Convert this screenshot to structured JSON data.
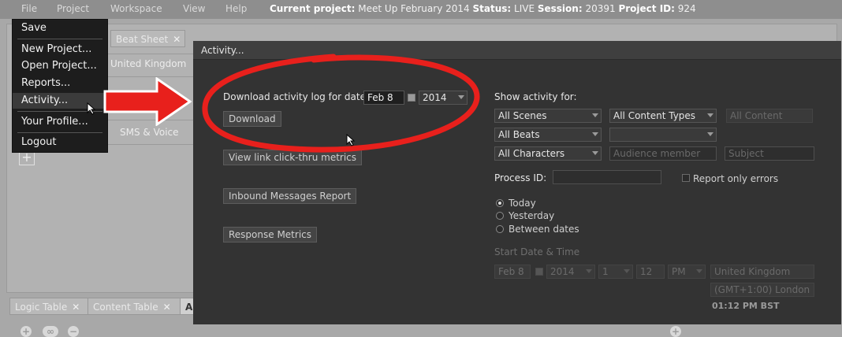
{
  "menubar": {
    "items": [
      "File",
      "Project",
      "Workspace",
      "View",
      "Help"
    ],
    "status": {
      "project_label": "Current project:",
      "project_value": "Meet Up February 2014",
      "status_label": "Status:",
      "status_value": "LIVE",
      "session_label": "Session:",
      "session_value": "20391",
      "project_id_label": "Project ID:",
      "project_id_value": "924"
    }
  },
  "background": {
    "beat_sheet_tab": "Beat Sheet",
    "region_label": "United Kingdom",
    "sms_voice_label": "SMS & Voice",
    "bottom_tabs": [
      "Logic Table",
      "Content Table",
      "Au"
    ],
    "close_glyph": "✕"
  },
  "project_menu": {
    "items": [
      {
        "label": "Save"
      },
      {
        "label": "New Project..."
      },
      {
        "label": "Open Project..."
      },
      {
        "label": "Reports..."
      },
      {
        "label": "Activity..."
      },
      {
        "label": "Your Profile..."
      },
      {
        "label": "Logout"
      }
    ],
    "highlighted": "Activity..."
  },
  "dialog": {
    "title": "Activity...",
    "download": {
      "label": "Download activity log for date:",
      "date_value": "Feb 8",
      "year_value": "2014",
      "button": "Download"
    },
    "buttons": {
      "link_clickthru": "View link click-thru metrics",
      "inbound_messages": "Inbound Messages Report",
      "response_metrics": "Response Metrics"
    },
    "show_activity": {
      "label": "Show activity for:",
      "scenes": "All Scenes",
      "content_types": "All Content Types",
      "content": "All Content",
      "beats": "All Beats",
      "characters": "All Characters",
      "audience_placeholder": "Audience member",
      "subject_placeholder": "Subject"
    },
    "process_id_label": "Process ID:",
    "report_errors_label": "Report only errors",
    "radios": {
      "today": "Today",
      "yesterday": "Yesterday",
      "between": "Between dates",
      "selected": "Today"
    },
    "start": {
      "label": "Start Date & Time",
      "date": "Feb 8",
      "year": "2014",
      "hour_select": "1",
      "minute": "12",
      "ampm": "PM",
      "region": "United Kingdom",
      "timezone": "(GMT+1:00) London",
      "time_readout": "01:12 PM BST"
    }
  },
  "colors": {
    "annotation_red": "#e8201c",
    "dialog_bg": "#333333",
    "menu_bg": "#1d1d1d"
  }
}
